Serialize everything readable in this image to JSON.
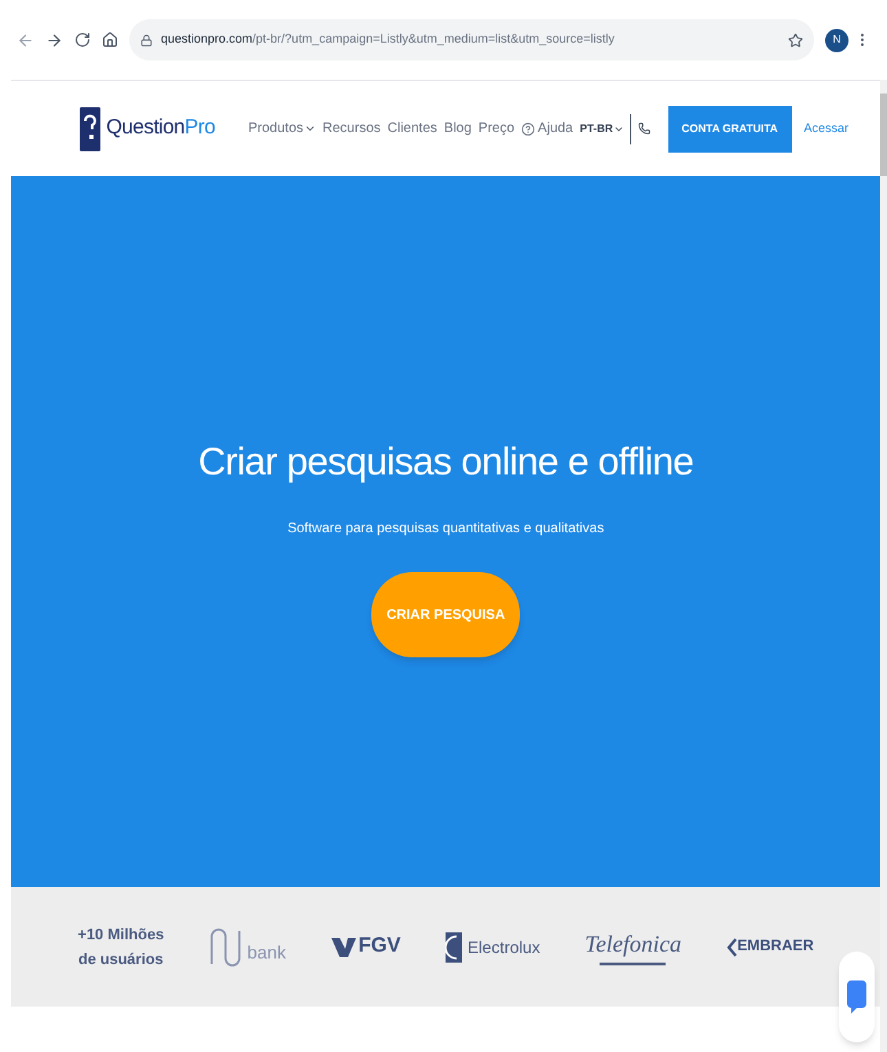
{
  "browser": {
    "url_host": "questionpro.com",
    "url_path": "/pt-br/?utm_campaign=Listly&utm_medium=list&utm_source=listly",
    "profile_initial": "N"
  },
  "header": {
    "logo": {
      "part1": "Question",
      "part2": "Pro"
    },
    "nav": [
      {
        "label": "Produtos",
        "kind": "dropdown"
      },
      {
        "label": "Recursos",
        "kind": "link"
      },
      {
        "label": "Clientes",
        "kind": "link"
      },
      {
        "label": "Blog",
        "kind": "link"
      },
      {
        "label": "Preço",
        "kind": "link"
      },
      {
        "label": "Ajuda",
        "kind": "help"
      },
      {
        "label": "PT-BR",
        "kind": "language"
      }
    ],
    "cta": "CONTA GRATUITA",
    "login": "Acessar"
  },
  "hero": {
    "title": "Criar pesquisas online e offline",
    "subtitle": "Software para pesquisas quantitativas e qualitativas",
    "button": "CRIAR PESQUISA"
  },
  "clients": {
    "stat": [
      "+10 Milhões",
      "de usuários"
    ],
    "logos": [
      {
        "kind": "nubank",
        "text": "bank"
      },
      {
        "kind": "fgv",
        "text": "FGV"
      },
      {
        "kind": "electrolux",
        "text": "Electrolux"
      },
      {
        "kind": "telefonica",
        "text": "Telefonica"
      },
      {
        "kind": "embraer",
        "text": "EMBRAER"
      }
    ]
  }
}
